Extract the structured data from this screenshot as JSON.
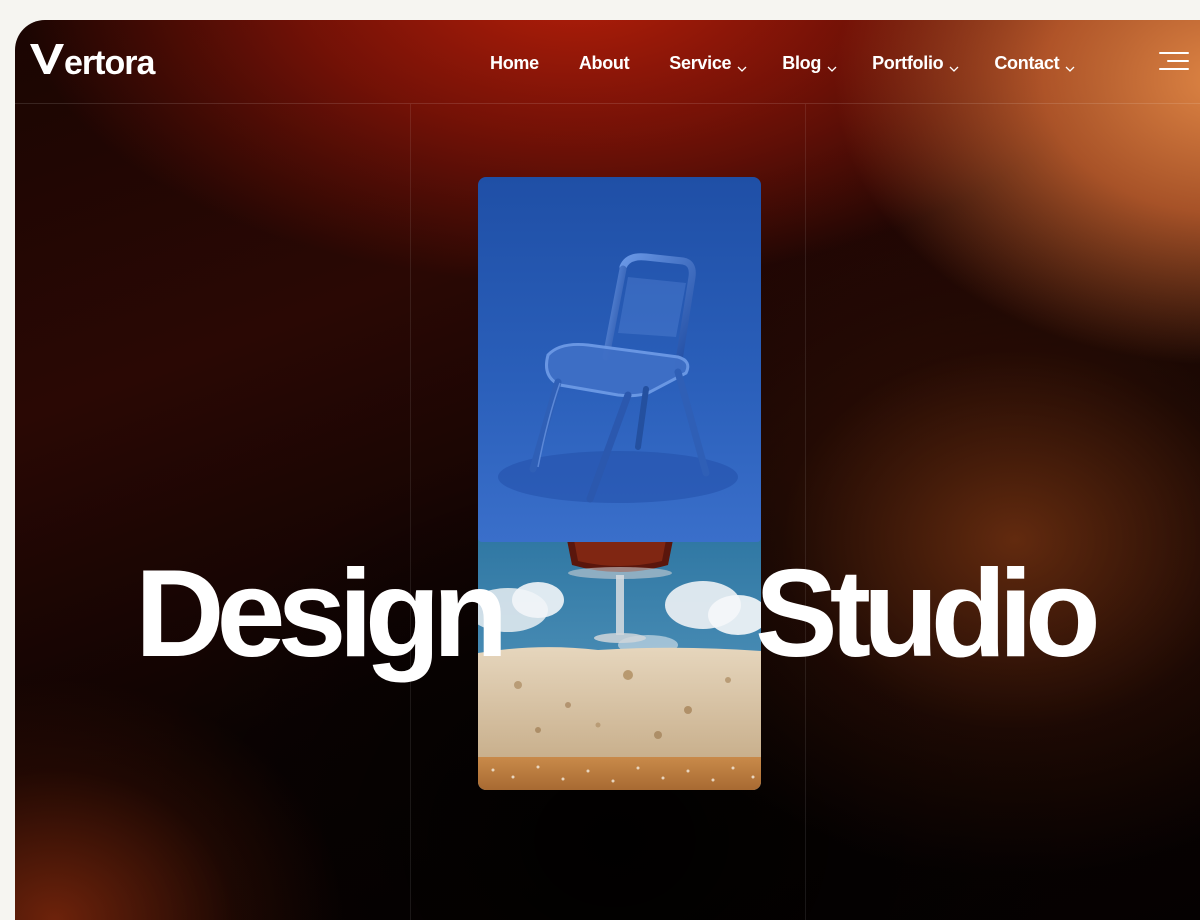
{
  "brand": {
    "name": "ertora",
    "mark_icon": "v-logo-mark"
  },
  "nav": {
    "items": [
      {
        "label": "Home",
        "dropdown": false
      },
      {
        "label": "About",
        "dropdown": false
      },
      {
        "label": "Service",
        "dropdown": true
      },
      {
        "label": "Blog",
        "dropdown": true
      },
      {
        "label": "Portfolio",
        "dropdown": true
      },
      {
        "label": "Contact",
        "dropdown": true
      }
    ],
    "menu_icon": "hamburger-menu-icon"
  },
  "hero": {
    "word_left": "Design",
    "word_right": "Studio",
    "images": [
      {
        "subject": "blue-chair-photo"
      },
      {
        "subject": "glass-on-stone-photo"
      }
    ]
  },
  "colors": {
    "text": "#ffffff",
    "accent_red": "#b3200c",
    "accent_orange": "#e08a48",
    "background_dark": "#050101",
    "page_bg": "#f6f5f1"
  }
}
